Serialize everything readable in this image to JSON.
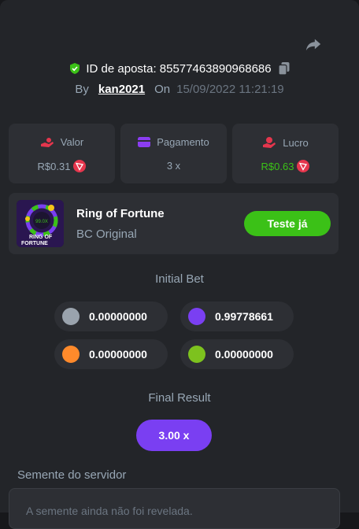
{
  "header": {
    "bet_id_label": "ID de aposta: 85577463890968686",
    "by_label": "By",
    "username": "kan2021",
    "on_label": "On",
    "date": "15/09/2022 11:21:19"
  },
  "stats": [
    {
      "label": "Valor",
      "value": "R$0.31",
      "icon": "money-hand-icon",
      "value_color": "#98a7b5"
    },
    {
      "label": "Pagamento",
      "value": "3 x",
      "icon": "wallet-icon",
      "value_color": "#98a7b5"
    },
    {
      "label": "Lucro",
      "value": "R$0.63",
      "icon": "profit-hand-icon",
      "value_color": "#3bc117"
    }
  ],
  "game": {
    "title": "Ring of Fortune",
    "subtitle": "BC Original",
    "try_label": "Teste já",
    "thumb_text_1": "RING OF",
    "thumb_text_2": "FORTUNE",
    "thumb_multiplier": "99.0X"
  },
  "initial_bet": {
    "title": "Initial Bet",
    "items": [
      {
        "color": "#9aa3ad",
        "amount": "0.00000000"
      },
      {
        "color": "#7a3ff2",
        "amount": "0.99778661"
      },
      {
        "color": "#ff8a2b",
        "amount": "0.00000000"
      },
      {
        "color": "#7dc21e",
        "amount": "0.00000000"
      }
    ]
  },
  "final_result": {
    "title": "Final Result",
    "value": "3.00 x"
  },
  "server_seed": {
    "label": "Semente do servidor",
    "text": "A semente ainda não foi revelada."
  },
  "colors": {
    "accent_green": "#3bc117",
    "accent_purple": "#7a3ff2",
    "coin_red": "#e5364d"
  }
}
